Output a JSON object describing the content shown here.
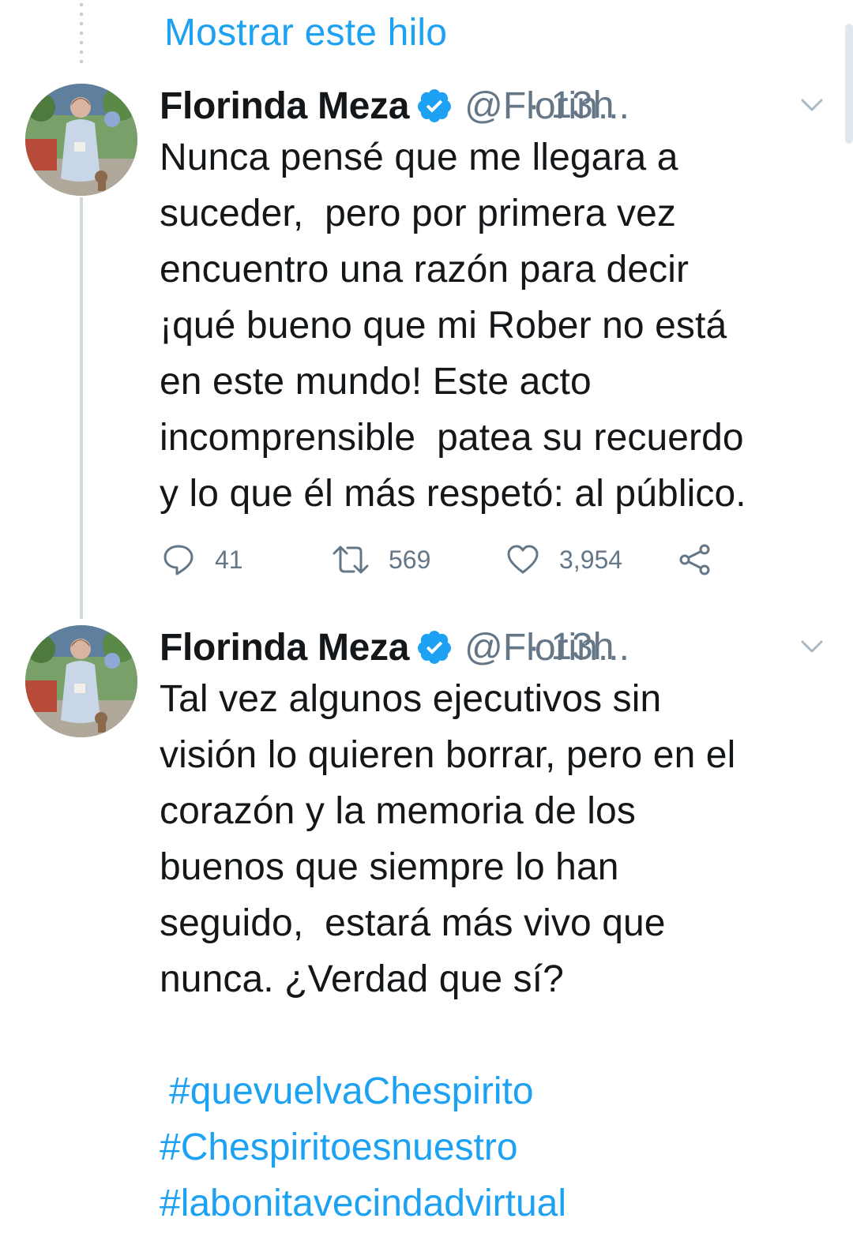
{
  "thread": {
    "show_thread_label": "Mostrar este hilo"
  },
  "colors": {
    "link": "#1da1f2",
    "secondary": "#657786",
    "verified": "#1da1f2"
  },
  "tweets": [
    {
      "author_name": "Florinda Meza",
      "handle": "@Florin...",
      "time": "· 13h",
      "text": "Nunca pensé que me llegara a\nsuceder,  pero por primera vez\nencuentro una razón para decir\n¡qué bueno que mi Rober no está\nen este mundo! Este acto\nincomprensible  patea su recuerdo\ny lo que él más respetó: al público.",
      "icons": {
        "verified": "verified-badge-icon",
        "menu": "chevron-down-icon",
        "reply": "reply-icon",
        "retweet": "retweet-icon",
        "like": "heart-icon",
        "share": "share-icon"
      },
      "stats": {
        "replies": "41",
        "retweets": "569",
        "likes": "3,954"
      }
    },
    {
      "author_name": "Florinda Meza",
      "handle": "@Florin...",
      "time": "· 13h",
      "text": "Tal vez algunos ejecutivos sin\nvisión lo quieren borrar, pero en el\ncorazón y la memoria de los\nbuenos que siempre lo han\nseguido,  estará más vivo que\nnunca. ¿Verdad que sí?",
      "hashtags": [
        "#quevuelvaChespirito",
        "#Chespiritoesnuestro",
        "#labonitavecindadvirtual"
      ]
    }
  ]
}
